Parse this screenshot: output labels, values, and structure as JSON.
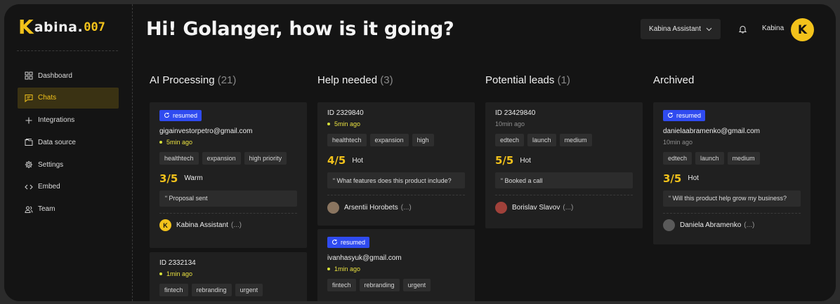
{
  "brand": {
    "k": "K",
    "text": "abina.",
    "num": "007"
  },
  "sidebar": {
    "items": [
      {
        "label": "Dashboard",
        "icon": "dashboard-icon"
      },
      {
        "label": "Chats",
        "icon": "chat-icon",
        "active": true
      },
      {
        "label": "Integrations",
        "icon": "plus-icon"
      },
      {
        "label": "Data source",
        "icon": "folder-icon"
      },
      {
        "label": "Settings",
        "icon": "gear-icon"
      },
      {
        "label": "Embed",
        "icon": "code-icon"
      },
      {
        "label": "Team",
        "icon": "team-icon"
      }
    ]
  },
  "header": {
    "greeting": "Hi! Golanger, how is it going?",
    "assistant_select": "Kabina Assistant",
    "user_name": "Kabina",
    "avatar_letter": "K"
  },
  "colors": {
    "accent": "#f2c21b",
    "badge": "#2f4bf0",
    "background": "#141414",
    "card": "#202020"
  },
  "columns": [
    {
      "title": "AI Processing",
      "count": "(21)",
      "cards": [
        {
          "badge": "resumed",
          "heading": "gigainvestorpetro@gmail.com",
          "time": "5min ago",
          "fresh": true,
          "tags": [
            "healthtech",
            "expansion",
            "high priority"
          ],
          "score": "3/5",
          "temp": "Warm",
          "quote": "“ Proposal sent",
          "owner": "Kabina Assistant",
          "owner_suffix": "(...)",
          "owner_avatar": "K"
        },
        {
          "heading": "ID 2332134",
          "time": "1min ago",
          "fresh": true,
          "tags": [
            "fintech",
            "rebranding",
            "urgent"
          ]
        }
      ]
    },
    {
      "title": "Help needed",
      "count": "(3)",
      "cards": [
        {
          "heading": "ID 2329840",
          "time": "5min ago",
          "fresh": true,
          "tags": [
            "healthtech",
            "expansion",
            "high"
          ],
          "score": "4/5",
          "temp": "Hot",
          "quote": "“ What features does this product include?",
          "owner": "Arsentii Horobets",
          "owner_suffix": "(...)"
        },
        {
          "badge": "resumed",
          "heading": "ivanhasyuk@gmail.com",
          "time": "1min ago",
          "fresh": true,
          "tags": [
            "fintech",
            "rebranding",
            "urgent"
          ]
        }
      ]
    },
    {
      "title": "Potential leads",
      "count": "(1)",
      "cards": [
        {
          "heading": "ID 23429840",
          "time": "10min ago",
          "fresh": false,
          "tags": [
            "edtech",
            "launch",
            "medium"
          ],
          "score": "5/5",
          "temp": "Hot",
          "quote": "“ Booked a call",
          "owner": "Borislav Slavov",
          "owner_suffix": "(...)"
        }
      ]
    },
    {
      "title": "Archived",
      "count": "",
      "cards": [
        {
          "badge": "resumed",
          "heading": "danielaabramenko@gmail.com",
          "time": "10min ago",
          "fresh": false,
          "tags": [
            "edtech",
            "launch",
            "medium"
          ],
          "score": "3/5",
          "temp": "Hot",
          "quote": "“ Will this product help grow my business?",
          "owner": "Daniela Abramenko",
          "owner_suffix": "(...)"
        }
      ]
    }
  ]
}
